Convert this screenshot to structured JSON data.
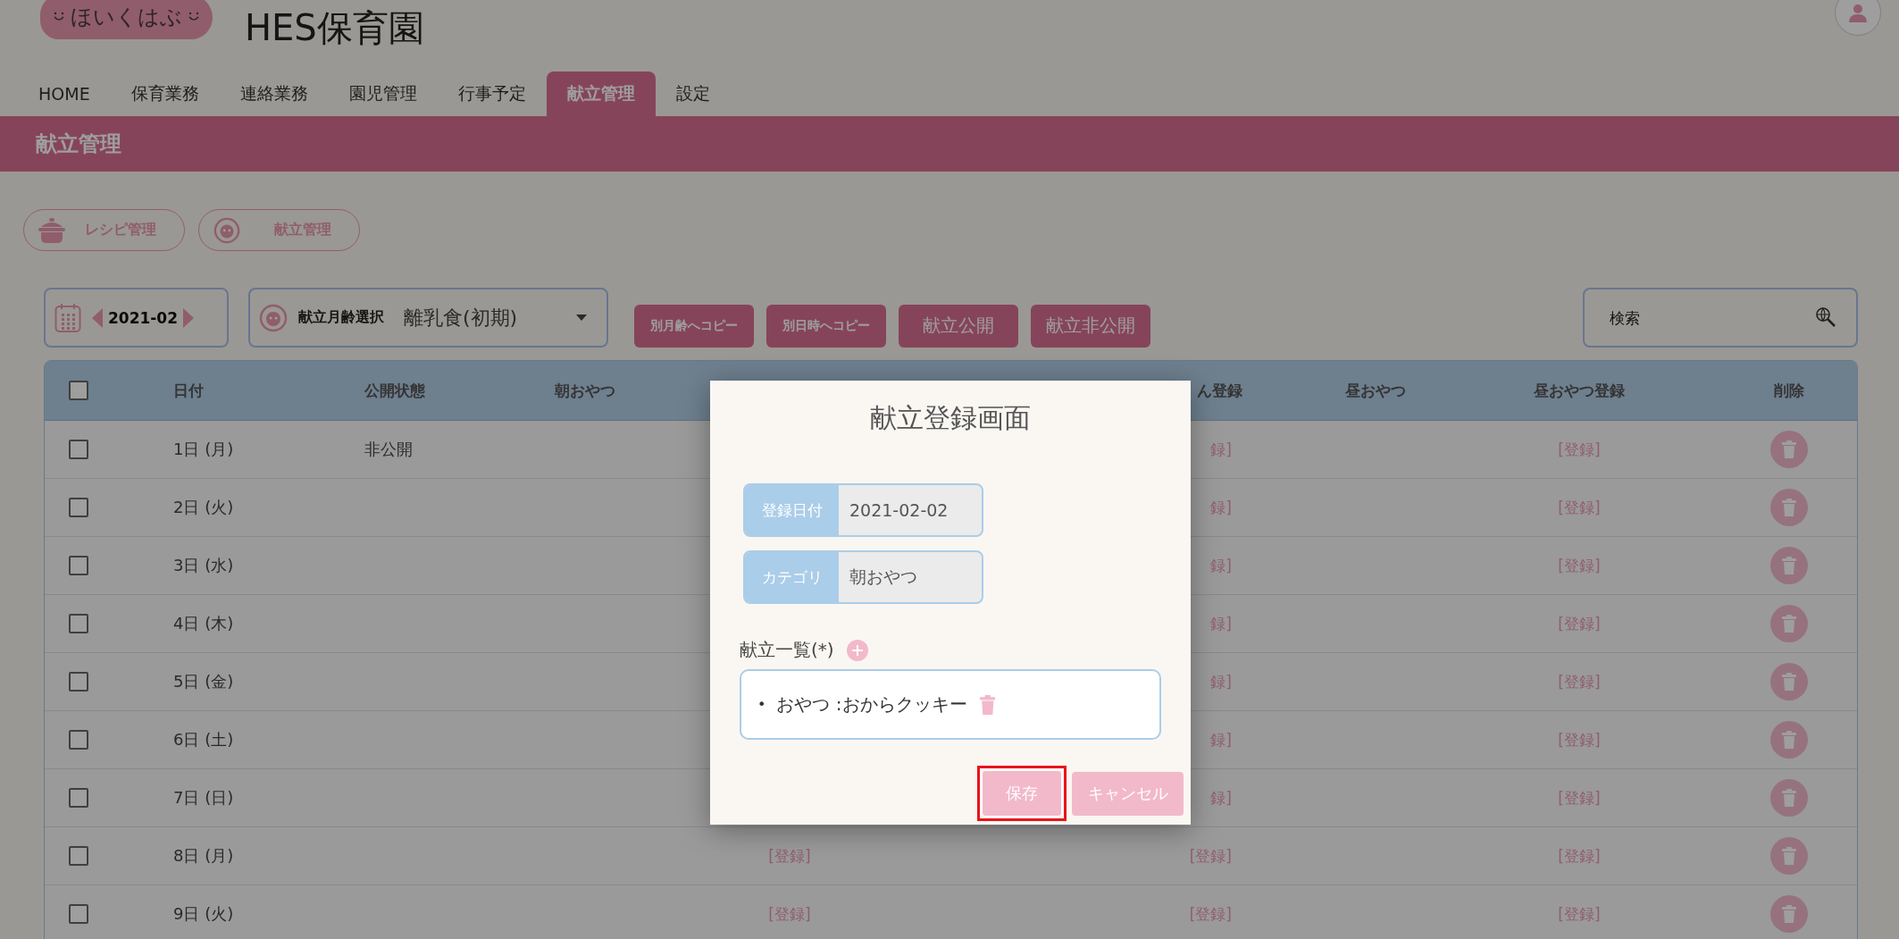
{
  "logo": {
    "text": "ほいくはぶ"
  },
  "app_title": "HES保育園",
  "nav_tabs": [
    {
      "label": "HOME",
      "selected": false
    },
    {
      "label": "保育業務",
      "selected": false
    },
    {
      "label": "連絡業務",
      "selected": false
    },
    {
      "label": "園児管理",
      "selected": false
    },
    {
      "label": "行事予定",
      "selected": false
    },
    {
      "label": "献立管理",
      "selected": true
    },
    {
      "label": "設定",
      "selected": false
    }
  ],
  "page_title": "献立管理",
  "sub_nav": [
    {
      "label": "レシピ管理",
      "kind": "recipe"
    },
    {
      "label": "献立管理",
      "kind": "menu"
    }
  ],
  "month_picker": {
    "value": "2021-02"
  },
  "age_select": {
    "label": "献立月齢選択",
    "value": "離乳食(初期)"
  },
  "actions": [
    {
      "label": "別月齢へコピー",
      "kind": "copy"
    },
    {
      "label": "別日時へコピー",
      "kind": "copy"
    },
    {
      "label": "献立公開",
      "kind": "publish"
    },
    {
      "label": "献立非公開",
      "kind": "publish"
    }
  ],
  "search": {
    "placeholder": "検索"
  },
  "table": {
    "columns": [
      {
        "kind": "checkbox",
        "checked": false
      },
      {
        "kind": "text",
        "label": "日付"
      },
      {
        "kind": "text",
        "label": "公開状態"
      },
      {
        "kind": "text",
        "label": "朝おやつ"
      },
      {
        "kind": "text"
      },
      {
        "kind": "text"
      },
      {
        "kind": "text",
        "label": "ん登録"
      },
      {
        "kind": "text",
        "label": "昼おやつ"
      },
      {
        "kind": "text",
        "label": "昼おやつ登録"
      },
      {
        "kind": "text",
        "label": "削除"
      }
    ],
    "rows": [
      {
        "checked": false,
        "date": "1日 (月)",
        "status": "非公開",
        "column_7": "録]",
        "lunch_snack_register": "[登録]"
      },
      {
        "checked": false,
        "date": "2日 (火)",
        "column_7": "録]",
        "lunch_snack_register": "[登録]"
      },
      {
        "checked": false,
        "date": "3日 (水)",
        "column_7": "録]",
        "lunch_snack_register": "[登録]"
      },
      {
        "checked": false,
        "date": "4日 (木)",
        "column_7": "録]",
        "lunch_snack_register": "[登録]"
      },
      {
        "checked": false,
        "date": "5日 (金)",
        "column_7": "録]",
        "lunch_snack_register": "[登録]"
      },
      {
        "checked": false,
        "date": "6日 (土)",
        "column_7": "録]",
        "lunch_snack_register": "[登録]"
      },
      {
        "checked": false,
        "date": "7日 (日)",
        "column_7": "録]",
        "lunch_snack_register": "[登録]"
      },
      {
        "checked": false,
        "date": "8日 (月)",
        "column_5": "[登録]",
        "column_7": "[登録]",
        "lunch_snack_register": "[登録]"
      },
      {
        "checked": false,
        "date": "9日 (火)",
        "column_5": "[登録]",
        "column_7": "[登録]",
        "lunch_snack_register": "[登録]"
      }
    ]
  },
  "modal": {
    "title": "献立登録画面",
    "fields": [
      {
        "label": "登録日付",
        "value": "2021-02-02"
      },
      {
        "label": "カテゴリ",
        "value": "朝おやつ"
      }
    ],
    "list_label": "献立一覧(*)",
    "items": [
      {
        "bullet": "•",
        "text": "おやつ :おからクッキー"
      }
    ],
    "buttons": [
      {
        "label": "保存",
        "kind": "primary",
        "highlighted": true
      },
      {
        "label": "キャンセル",
        "kind": "secondary",
        "highlighted": false
      }
    ]
  }
}
